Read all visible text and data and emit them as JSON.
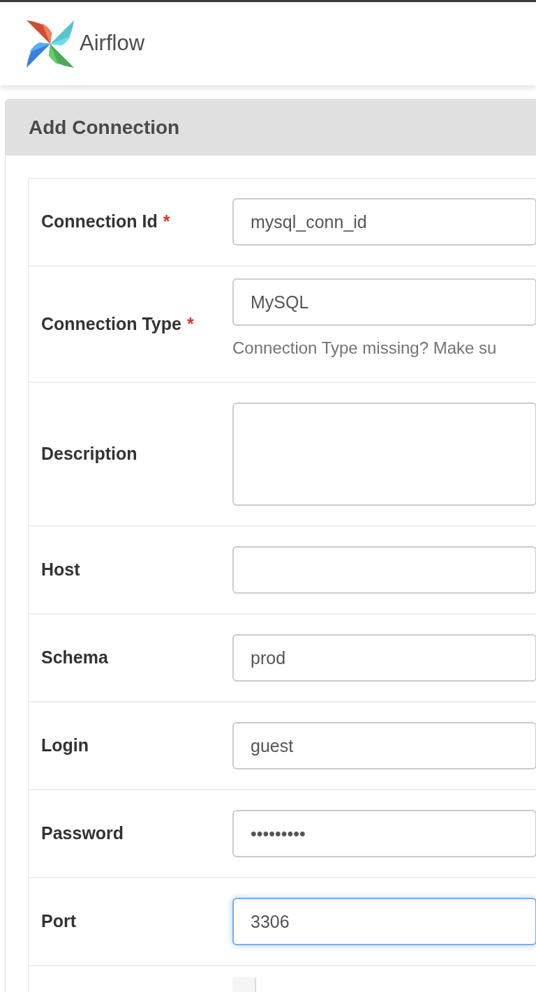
{
  "brand": {
    "name": "Airflow"
  },
  "panel": {
    "title": "Add Connection"
  },
  "fields": [
    {
      "kind": "text",
      "label": "Connection Id",
      "required_mark": "*",
      "value": "mysql_conn_id",
      "focused": false
    },
    {
      "kind": "text",
      "label": "Connection Type",
      "required_mark": "*",
      "value": "MySQL",
      "hint": "Connection Type missing? Make su",
      "focused": false
    },
    {
      "kind": "textarea",
      "label": "Description",
      "focused": false
    },
    {
      "kind": "text",
      "label": "Host",
      "focused": false
    },
    {
      "kind": "text",
      "label": "Schema",
      "value": "prod",
      "focused": false
    },
    {
      "kind": "text",
      "label": "Login",
      "value": "guest",
      "focused": false
    },
    {
      "kind": "text",
      "label": "Password",
      "value": "•••••••••",
      "focused": false
    },
    {
      "kind": "text",
      "label": "Port",
      "value": "3306",
      "focused": true
    },
    {
      "kind": "code"
    }
  ]
}
